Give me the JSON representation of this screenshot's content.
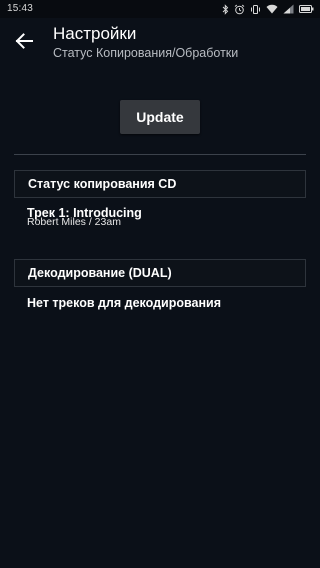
{
  "status_bar": {
    "time": "15:43",
    "icons": [
      "bluetooth-icon",
      "alarm-icon",
      "vibrate-icon",
      "wifi-icon",
      "signal-icon",
      "battery-icon"
    ]
  },
  "app_bar": {
    "back_icon": "arrow-back-icon",
    "title": "Настройки",
    "subtitle": "Статус Копирования/Обработки"
  },
  "update_button": {
    "label": "Update"
  },
  "cd_copy_section": {
    "header": "Статус копирования CD",
    "track_title": "Трек 1: Introducing",
    "track_artist": "Robert Miles / 23am"
  },
  "decode_section": {
    "header": "Декодирование (DUAL)",
    "empty_text": "Нет треков для декодирования"
  },
  "colors": {
    "background": "#0b1018",
    "status_bar": "#080b10",
    "button": "#35383d",
    "divider": "#3c424b",
    "text_primary": "#ffffff",
    "text_secondary": "#b8bcc2"
  }
}
